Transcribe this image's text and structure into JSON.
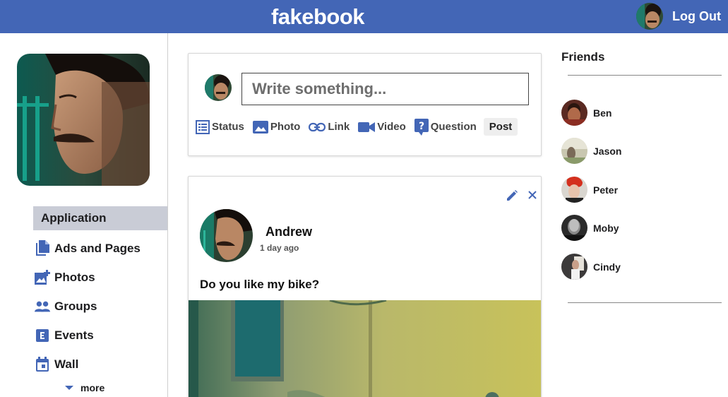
{
  "header": {
    "brand": "fakebook",
    "logout_label": "Log Out"
  },
  "sidebar": {
    "items": [
      {
        "label": "Application",
        "icon": "none"
      },
      {
        "label": "Ads and Pages",
        "icon": "file-copy-icon"
      },
      {
        "label": "Photos",
        "icon": "add-photo-icon"
      },
      {
        "label": "Groups",
        "icon": "people-icon"
      },
      {
        "label": "Events",
        "icon": "events-icon"
      },
      {
        "label": "Wall",
        "icon": "calendar-icon"
      }
    ],
    "more_label": "more"
  },
  "composer": {
    "placeholder": "Write something...",
    "actions": [
      {
        "label": "Status",
        "icon": "list-icon"
      },
      {
        "label": "Photo",
        "icon": "image-icon"
      },
      {
        "label": "Link",
        "icon": "link-icon"
      },
      {
        "label": "Video",
        "icon": "video-icon"
      },
      {
        "label": "Question",
        "icon": "question-icon"
      }
    ],
    "post_label": "Post"
  },
  "post": {
    "author": "Andrew",
    "time": "1 day ago",
    "text": "Do you like my bike?"
  },
  "friends": {
    "title": "Friends",
    "list": [
      {
        "name": "Ben"
      },
      {
        "name": "Jason"
      },
      {
        "name": "Peter"
      },
      {
        "name": "Moby"
      },
      {
        "name": "Cindy"
      }
    ]
  },
  "colors": {
    "brand_blue": "#4366b6",
    "active_menu_bg": "#c9ccd6"
  }
}
